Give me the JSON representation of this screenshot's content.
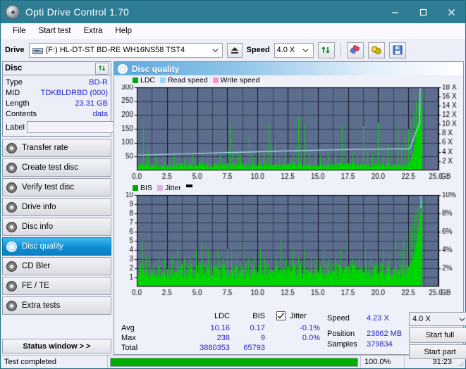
{
  "window": {
    "title": "Opti Drive Control 1.70",
    "icon": "disc-icon",
    "minimize": "–",
    "maximize": "□",
    "close": "✕"
  },
  "menu": {
    "items": [
      "File",
      "Start test",
      "Extra",
      "Help"
    ]
  },
  "toolbar": {
    "drive_label": "Drive",
    "drive_value": "(F:)  HL-DT-ST BD-RE  WH16NS58 TST4",
    "eject_title": "Eject",
    "speed_label": "Speed",
    "speed_value": "4.0 X",
    "buttons": [
      "refresh-icon",
      "eraser-icon",
      "coins-icon",
      "save-icon"
    ]
  },
  "sidebar": {
    "disc": {
      "title": "Disc",
      "refresh_icon": "refresh-icon",
      "rows": [
        {
          "key": "Type",
          "value": "BD-R"
        },
        {
          "key": "MID",
          "value": "TDKBLDRBD (000)"
        },
        {
          "key": "Length",
          "value": "23.31 GB"
        },
        {
          "key": "Contents",
          "value": "data"
        }
      ],
      "label_key": "Label",
      "label_value": "",
      "label_placeholder": ""
    },
    "nav": [
      {
        "label": "Transfer rate",
        "active": false
      },
      {
        "label": "Create test disc",
        "active": false
      },
      {
        "label": "Verify test disc",
        "active": false
      },
      {
        "label": "Drive info",
        "active": false
      },
      {
        "label": "Disc info",
        "active": false
      },
      {
        "label": "Disc quality",
        "active": true
      },
      {
        "label": "CD Bler",
        "active": false
      },
      {
        "label": "FE / TE",
        "active": false
      },
      {
        "label": "Extra tests",
        "active": false
      }
    ],
    "status_button": "Status window > >"
  },
  "panel": {
    "title": "Disc quality",
    "icon": "disc-quality-icon"
  },
  "chart_data": [
    {
      "type": "line",
      "title": "LDC / Read speed",
      "xlabel": "GB",
      "ylabel": "LDC",
      "xlim": [
        0.0,
        25.0
      ],
      "x_ticks": [
        "0.0",
        "2.5",
        "5.0",
        "7.5",
        "10.0",
        "12.5",
        "15.0",
        "17.5",
        "20.0",
        "22.5",
        "25.0"
      ],
      "x_unit": "GB",
      "ylim": [
        0,
        300
      ],
      "y_ticks": [
        "50",
        "100",
        "150",
        "200",
        "250",
        "300"
      ],
      "y2lim": [
        0,
        18
      ],
      "y2_ticks": [
        "2 X",
        "4 X",
        "6 X",
        "8 X",
        "10 X",
        "12 X",
        "14 X",
        "16 X",
        "18 X"
      ],
      "grid": true,
      "legend": [
        {
          "name": "LDC",
          "color": "#00a800"
        },
        {
          "name": "Read speed",
          "color": "#9cd6f0"
        },
        {
          "name": "Write speed",
          "color": "#ff8fd0"
        }
      ],
      "series": [
        {
          "name": "LDC",
          "color": "#00d400",
          "baseline": 22,
          "data_end_gb": 23.6,
          "spikes": [
            [
              0.55,
              165
            ],
            [
              0.8,
              72
            ],
            [
              0.95,
              60
            ],
            [
              1.6,
              55
            ],
            [
              2.2,
              48
            ],
            [
              3.1,
              52
            ],
            [
              3.9,
              45
            ],
            [
              4.6,
              58
            ],
            [
              5.4,
              50
            ],
            [
              6.2,
              44
            ],
            [
              6.9,
              52
            ],
            [
              7.55,
              78
            ],
            [
              7.7,
              160
            ],
            [
              7.95,
              60
            ],
            [
              8.4,
              70
            ],
            [
              8.6,
              55
            ],
            [
              9.3,
              126
            ],
            [
              9.6,
              58
            ],
            [
              10.1,
              70
            ],
            [
              10.5,
              62
            ],
            [
              10.9,
              168
            ],
            [
              11.1,
              102
            ],
            [
              11.45,
              100
            ],
            [
              11.8,
              55
            ],
            [
              12.3,
              60
            ],
            [
              12.9,
              54
            ],
            [
              13.35,
              193
            ],
            [
              13.6,
              66
            ],
            [
              13.9,
              162
            ],
            [
              14.3,
              76
            ],
            [
              14.75,
              58
            ],
            [
              15.2,
              52
            ],
            [
              15.9,
              60
            ],
            [
              16.4,
              54
            ],
            [
              17.0,
              164
            ],
            [
              17.4,
              58
            ],
            [
              17.9,
              66
            ],
            [
              18.3,
              56
            ],
            [
              18.75,
              160
            ],
            [
              19.1,
              70
            ],
            [
              19.5,
              62
            ],
            [
              20.0,
              172
            ],
            [
              20.4,
              60
            ],
            [
              20.8,
              96
            ],
            [
              21.2,
              70
            ],
            [
              21.6,
              164
            ],
            [
              21.9,
              88
            ],
            [
              22.2,
              120
            ],
            [
              22.5,
              150
            ],
            [
              22.75,
              180
            ],
            [
              22.95,
              210
            ],
            [
              23.15,
              250
            ],
            [
              23.35,
              285
            ]
          ]
        },
        {
          "name": "Read speed",
          "color": "#9cd6f0",
          "points": [
            [
              0.0,
              3.3
            ],
            [
              2.0,
              3.45
            ],
            [
              4.0,
              3.6
            ],
            [
              6.0,
              3.75
            ],
            [
              8.0,
              3.9
            ],
            [
              10.0,
              4.05
            ],
            [
              12.0,
              4.2
            ],
            [
              14.0,
              4.3
            ],
            [
              16.0,
              4.45
            ],
            [
              18.0,
              4.55
            ],
            [
              20.0,
              4.6
            ],
            [
              21.5,
              4.65
            ],
            [
              22.6,
              4.65
            ],
            [
              23.4,
              10.0
            ],
            [
              23.5,
              18.0
            ]
          ]
        }
      ]
    },
    {
      "type": "line",
      "title": "BIS / Jitter",
      "xlabel": "GB",
      "ylabel": "BIS",
      "xlim": [
        0.0,
        25.0
      ],
      "x_ticks": [
        "0.0",
        "2.5",
        "5.0",
        "7.5",
        "10.0",
        "12.5",
        "15.0",
        "17.5",
        "20.0",
        "22.5",
        "25.0"
      ],
      "x_unit": "GB",
      "ylim": [
        0,
        10
      ],
      "y_ticks": [
        "1",
        "2",
        "3",
        "4",
        "5",
        "6",
        "7",
        "8",
        "9",
        "10"
      ],
      "y2lim": [
        0,
        10
      ],
      "y2_ticks": [
        "2%",
        "4%",
        "6%",
        "8%",
        "10%"
      ],
      "grid": true,
      "legend": [
        {
          "name": "BIS",
          "color": "#00a800"
        },
        {
          "name": "Jitter",
          "color": "#d8b6e0"
        }
      ],
      "series": [
        {
          "name": "BIS",
          "color": "#00d400",
          "baseline": 2.0,
          "data_end_gb": 23.6,
          "spikes": [
            [
              0.4,
              5.0
            ],
            [
              0.75,
              3.3
            ],
            [
              1.0,
              3.1
            ],
            [
              1.5,
              1.0
            ],
            [
              1.8,
              3.2
            ],
            [
              2.3,
              3.0
            ],
            [
              2.9,
              3.1
            ],
            [
              3.4,
              4.0
            ],
            [
              3.9,
              3.0
            ],
            [
              4.4,
              3.2
            ],
            [
              4.9,
              4.1
            ],
            [
              5.4,
              5.0
            ],
            [
              5.9,
              4.0
            ],
            [
              6.3,
              3.2
            ],
            [
              6.7,
              4.0
            ],
            [
              7.1,
              3.1
            ],
            [
              7.5,
              4.1
            ],
            [
              7.8,
              4.0
            ],
            [
              8.3,
              3.2
            ],
            [
              8.8,
              5.0
            ],
            [
              9.2,
              3.1
            ],
            [
              9.7,
              3.2
            ],
            [
              10.2,
              4.0
            ],
            [
              10.6,
              3.1
            ],
            [
              11.0,
              1.0
            ],
            [
              11.5,
              3.2
            ],
            [
              11.9,
              5.0
            ],
            [
              12.4,
              3.1
            ],
            [
              12.9,
              4.0
            ],
            [
              13.4,
              3.2
            ],
            [
              13.9,
              4.1
            ],
            [
              14.4,
              3.0
            ],
            [
              14.9,
              3.2
            ],
            [
              15.4,
              4.0
            ],
            [
              15.9,
              3.1
            ],
            [
              16.4,
              3.2
            ],
            [
              16.9,
              4.0
            ],
            [
              17.4,
              5.0
            ],
            [
              17.9,
              3.1
            ],
            [
              18.4,
              3.2
            ],
            [
              18.9,
              4.0
            ],
            [
              19.4,
              3.1
            ],
            [
              19.9,
              3.2
            ],
            [
              20.4,
              4.0
            ],
            [
              20.9,
              3.1
            ],
            [
              21.4,
              5.0
            ],
            [
              21.8,
              4.0
            ],
            [
              22.1,
              5.0
            ],
            [
              22.4,
              6.0
            ],
            [
              22.6,
              6.5
            ],
            [
              22.8,
              7.0
            ],
            [
              23.0,
              8.0
            ],
            [
              23.2,
              8.5
            ],
            [
              23.35,
              9.0
            ]
          ]
        }
      ]
    }
  ],
  "stats": {
    "col_headers": [
      "LDC",
      "BIS"
    ],
    "jitter_label": "Jitter",
    "jitter_checked": true,
    "rows": [
      {
        "label": "Avg",
        "ldc": "10.16",
        "bis": "0.17",
        "jitter": "-0.1%"
      },
      {
        "label": "Max",
        "ldc": "238",
        "bis": "9",
        "jitter": "0.0%"
      },
      {
        "label": "Total",
        "ldc": "3880353",
        "bis": "65793",
        "jitter": ""
      }
    ],
    "speed_label": "Speed",
    "speed_value": "4.23 X",
    "position_label": "Position",
    "position_value": "23862 MB",
    "samples_label": "Samples",
    "samples_value": "379834",
    "speed_select": "4.0 X",
    "start_full": "Start full",
    "start_part": "Start part"
  },
  "statusbar": {
    "message": "Test completed",
    "progress_percent": 100,
    "percent_text": "100.0%",
    "elapsed": "31:23"
  },
  "colors": {
    "titlebar": "#2e7d94",
    "plot_bg": "#5c6d8d",
    "ldc_green": "#00d400",
    "read_speed": "#9cd6f0",
    "accent_blue": "#2222cc",
    "progress_green": "#00b000"
  }
}
